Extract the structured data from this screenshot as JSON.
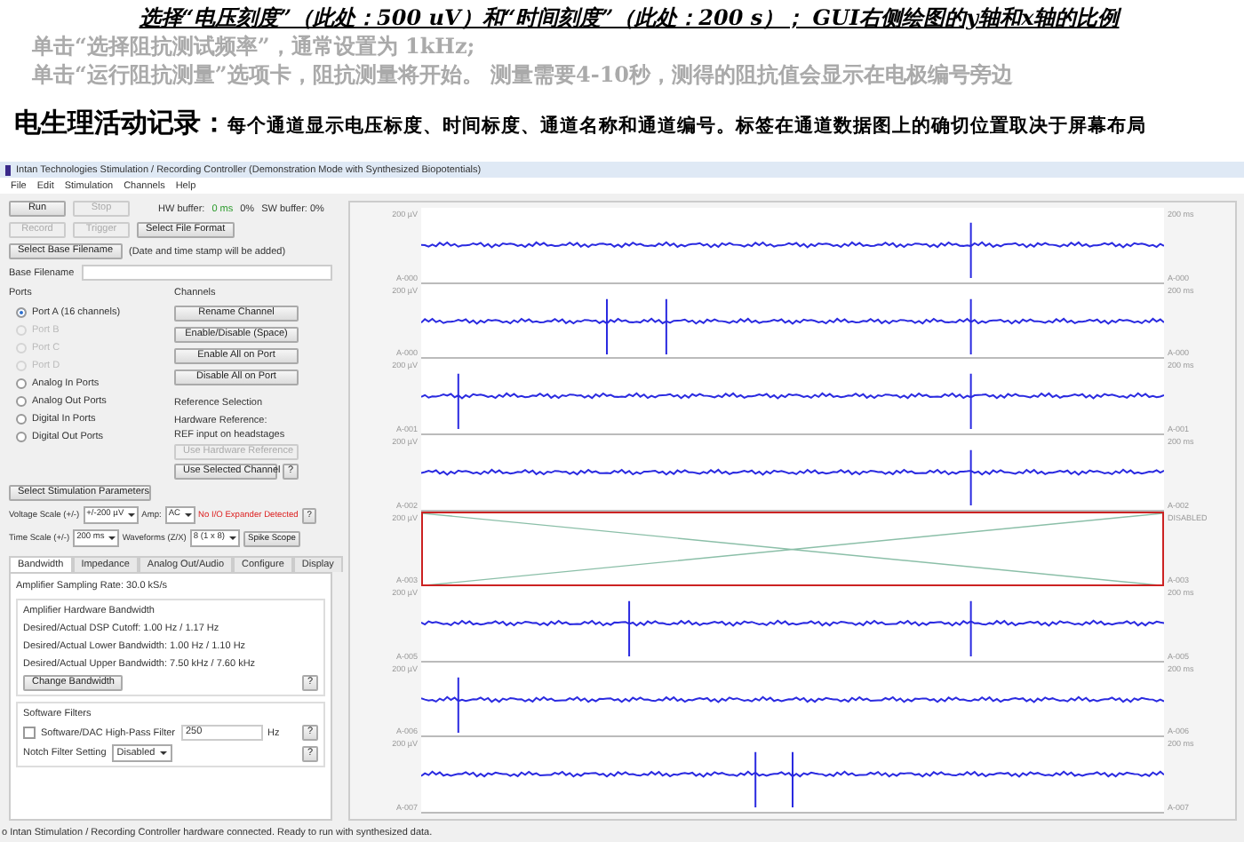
{
  "annotation": {
    "heading": "选择“电压刻度”（此处：500 uV）和“时间刻度”（此处：200 s）； GUI右侧绘图的y轴和x轴的比例",
    "notes": [
      "单击“选择阻抗测试频率”，通常设置为 1kHz;",
      "单击“运行阻抗测量”选项卡，阻抗测量将开始。 测量需要4-10秒，测得的阻抗值会显示在电极编号旁边"
    ],
    "title": "电生理活动记录：",
    "description": "每个通道显示电压标度、时间标度、通道名称和通道编号。标签在通道数据图上的确切位置取决于屏幕布局"
  },
  "window": {
    "title": "Intan Technologies Stimulation / Recording Controller (Demonstration Mode with Synthesized Biopotentials)"
  },
  "menu": [
    "File",
    "Edit",
    "Stimulation",
    "Channels",
    "Help"
  ],
  "controls": {
    "run_buttons": [
      {
        "label": "Run",
        "disabled": false
      },
      {
        "label": "Stop",
        "disabled": true
      }
    ],
    "hw_buffer_label": "HW buffer:",
    "hw_buffer_value": "0 ms",
    "hw_percent": "0%",
    "sw_buffer": "SW buffer: 0%",
    "record_buttons": [
      {
        "label": "Record",
        "disabled": true
      },
      {
        "label": "Trigger",
        "disabled": true
      },
      {
        "label": "Select File Format",
        "disabled": false
      }
    ],
    "base_filename_button": "Select Base Filename",
    "timestamp_note": "(Date and time stamp will be added)",
    "base_filename_label": "Base Filename"
  },
  "ports": {
    "title": "Ports",
    "items": [
      {
        "label": "Port A (16 channels)",
        "selected": true,
        "disabled": false
      },
      {
        "label": "Port B",
        "selected": false,
        "disabled": true
      },
      {
        "label": "Port C",
        "selected": false,
        "disabled": true
      },
      {
        "label": "Port D",
        "selected": false,
        "disabled": true
      },
      {
        "label": "Analog In Ports",
        "selected": false,
        "disabled": false
      },
      {
        "label": "Analog Out Ports",
        "selected": false,
        "disabled": false
      },
      {
        "label": "Digital In Ports",
        "selected": false,
        "disabled": false
      },
      {
        "label": "Digital Out Ports",
        "selected": false,
        "disabled": false
      }
    ]
  },
  "channels_group": {
    "title": "Channels",
    "buttons": [
      "Rename Channel",
      "Enable/Disable (Space)",
      "Enable All on Port",
      "Disable All on Port"
    ],
    "reference_title": "Reference Selection",
    "hardware_reference": "Hardware Reference:",
    "reference_value": "REF input on headstages",
    "reference_buttons": [
      {
        "label": "Use Hardware Reference",
        "disabled": true
      },
      {
        "label": "Use Selected Channel",
        "disabled": false
      }
    ],
    "help": "?"
  },
  "stim_button": "Select Stimulation Parameters",
  "scales": {
    "voltage_label": "Voltage Scale (+/-)",
    "voltage_value": "+/-200 µV",
    "amp_label": "Amp:",
    "amp_value": "AC",
    "expander_warning": "No I/O Expander Detected",
    "help": "?",
    "time_label": "Time Scale (+/-)",
    "time_value": "200 ms",
    "waveform_label": "Waveforms (Z/X)",
    "waveform_value": "8 (1 x 8)",
    "spike_button": "Spike Scope"
  },
  "tabs": [
    {
      "label": "Bandwidth",
      "selected": true
    },
    {
      "label": "Impedance",
      "selected": false
    },
    {
      "label": "Analog Out/Audio",
      "selected": false
    },
    {
      "label": "Configure",
      "selected": false
    },
    {
      "label": "Display",
      "selected": false
    }
  ],
  "bandwidth": {
    "sampling_rate": "Amplifier Sampling Rate: 30.0 kS/s",
    "hardware_title": "Amplifier Hardware Bandwidth",
    "lines": [
      "Desired/Actual DSP Cutoff: 1.00 Hz / 1.17 Hz",
      "Desired/Actual Lower Bandwidth: 1.00 Hz / 1.10 Hz",
      "Desired/Actual Upper Bandwidth: 7.50 kHz / 7.60 kHz"
    ],
    "change_button": "Change Bandwidth",
    "help": "?",
    "software_title": "Software Filters",
    "highpass": {
      "label": "Software/DAC High-Pass Filter",
      "checked": false,
      "value": "250",
      "unit": "Hz",
      "help": "?"
    },
    "notch": {
      "label": "Notch Filter Setting",
      "value": "Disabled",
      "help": "?"
    }
  },
  "plot_channels": [
    {
      "scale": "200 µV",
      "name": "A-000",
      "time": "200 ms",
      "right_name": "A-000",
      "disabled": false
    },
    {
      "scale": "200 µV",
      "name": "A-000",
      "time": "200 ms",
      "right_name": "A-000",
      "disabled": false
    },
    {
      "scale": "200 µV",
      "name": "A-001",
      "time": "200 ms",
      "right_name": "A-001",
      "disabled": false
    },
    {
      "scale": "200 µV",
      "name": "A-002",
      "time": "200 ms",
      "right_name": "A-002",
      "disabled": false
    },
    {
      "scale": "200 µV",
      "name": "A-003",
      "time": "DISABLED",
      "right_name": "A-003",
      "disabled": true
    },
    {
      "scale": "200 µV",
      "name": "A-005",
      "time": "200 ms",
      "right_name": "A-005",
      "disabled": false
    },
    {
      "scale": "200 µV",
      "name": "A-006",
      "time": "200 ms",
      "right_name": "A-006",
      "disabled": false
    },
    {
      "scale": "200 µV",
      "name": "A-007",
      "time": "200 ms",
      "right_name": "A-007",
      "disabled": false
    }
  ],
  "status_bar": "o Intan Stimulation / Recording Controller hardware connected. Ready to run with synthesized data."
}
